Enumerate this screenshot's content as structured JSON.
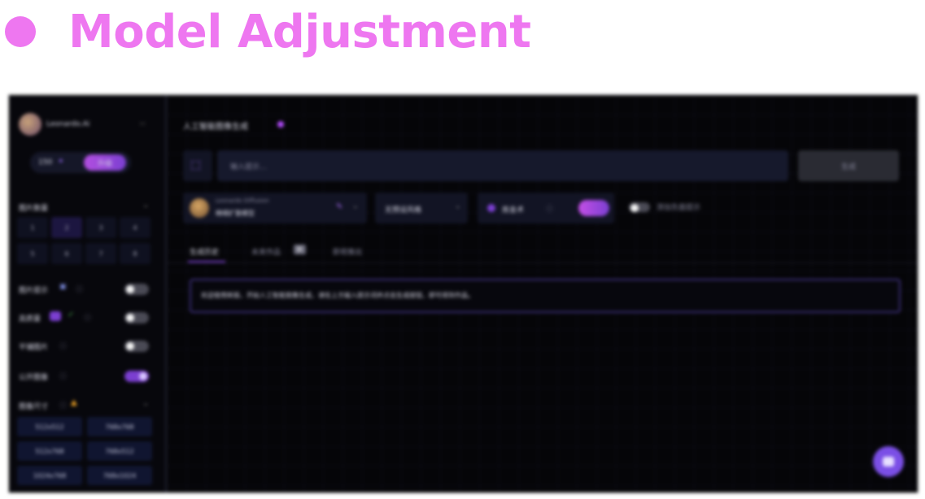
{
  "heading": {
    "title": "Model Adjustment",
    "accent": "#ee77f0"
  },
  "sidebar": {
    "user_name": "Leonardo.Ai",
    "tokens_label": "150",
    "upgrade_label": "升级",
    "section_images": "图片数量",
    "count_options": [
      "1",
      "2",
      "3",
      "4",
      "5",
      "6",
      "7",
      "8"
    ],
    "selected_count": "2",
    "toggles": [
      {
        "label": "图片提示",
        "on": false
      },
      {
        "label": "高质量",
        "on": false
      },
      {
        "label": "平铺图片",
        "on": false
      },
      {
        "label": "公开图像",
        "on": true
      }
    ],
    "section_dimensions": "图像尺寸",
    "size_options": [
      "512x512",
      "768x768",
      "512x768",
      "768x512",
      "1024x768",
      "768x1024"
    ]
  },
  "main": {
    "page_title": "人工智能图像生成",
    "prompt_placeholder": "输入提示…",
    "generate_button": "生成",
    "model_label": "Leonardo Diffusion",
    "model_sub": "精细扩散模型",
    "style_label": "无预设风格",
    "alchemy_label": "炼金术",
    "alchemy_on": true,
    "negative_label": "添加负面提示",
    "tabs": [
      "生成历史",
      "未来作品",
      "即将推出"
    ],
    "tab_badge": "新",
    "notice_text": "欢迎使用新版，开始人工智能图像生成，请在上方输入提示词并点击生成按钮，即可得到作品。"
  },
  "colors": {
    "brand": "#7b3fd1",
    "accent_pink": "#ee77f0",
    "dark_bg": "#050508"
  }
}
